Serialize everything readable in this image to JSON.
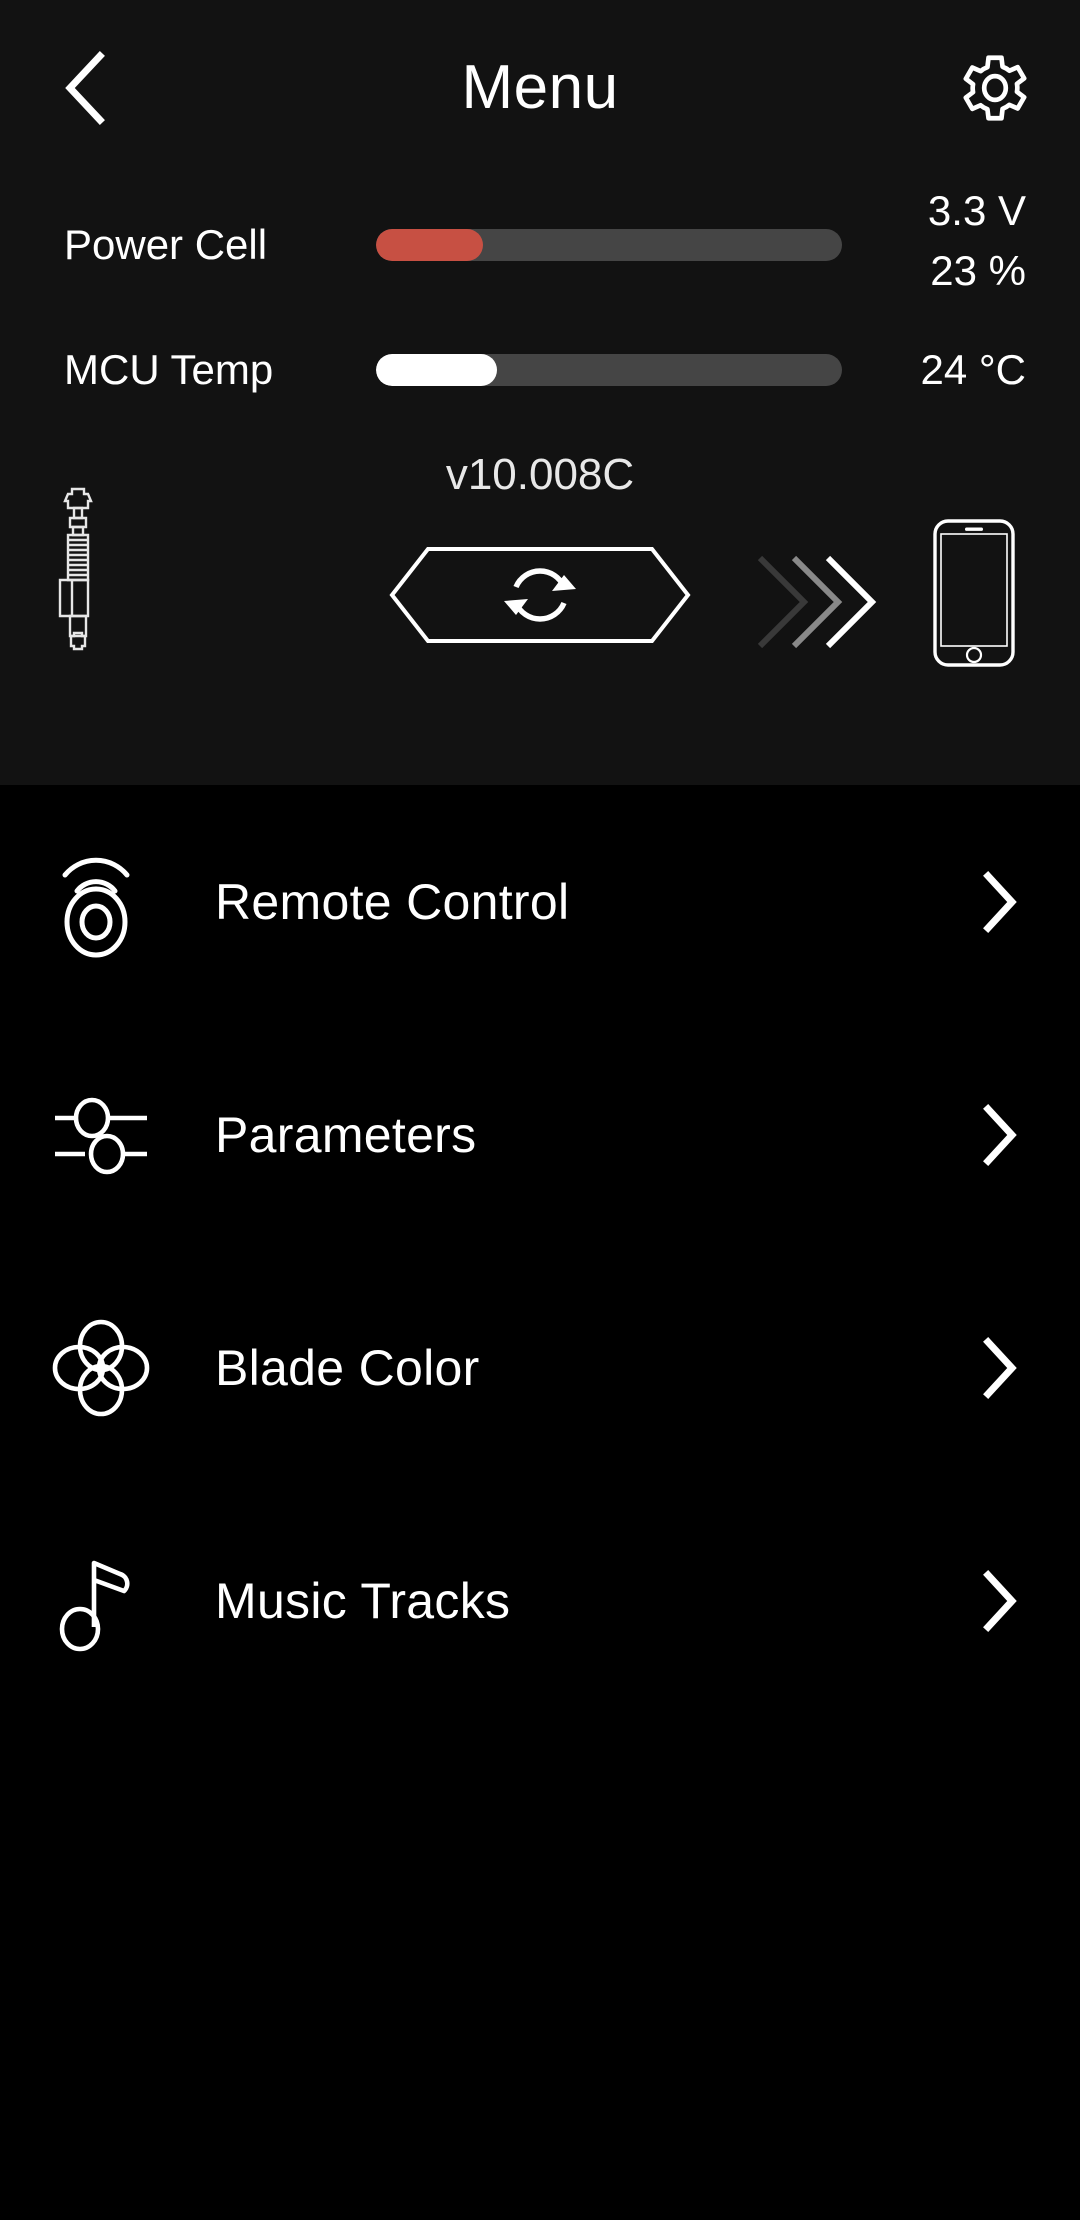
{
  "header": {
    "title": "Menu",
    "back_icon": "chevron-left-icon",
    "settings_icon": "gear-icon"
  },
  "stats": {
    "power_cell": {
      "label": "Power Cell",
      "percent": 23,
      "voltage_text": "3.3 V",
      "percent_text": "23 %",
      "fill_color": "#c75043",
      "track_color": "#454545"
    },
    "mcu_temp": {
      "label": "MCU Temp",
      "percent": 26,
      "value_text": "24 °C",
      "fill_color": "#ffffff",
      "track_color": "#454545"
    }
  },
  "sync": {
    "version": "v10.008C",
    "device_icon": "lightsaber-hilt-icon",
    "sync_button_icon": "refresh-sync-icon",
    "transfer_icon": "double-chevron-right-icon",
    "phone_icon": "smartphone-icon"
  },
  "menu": {
    "items": [
      {
        "label": "Remote Control",
        "icon": "remote-control-icon",
        "chevron": "chevron-right-icon"
      },
      {
        "label": "Parameters",
        "icon": "sliders-icon",
        "chevron": "chevron-right-icon"
      },
      {
        "label": "Blade Color",
        "icon": "color-wheel-icon",
        "chevron": "chevron-right-icon"
      },
      {
        "label": "Music Tracks",
        "icon": "music-note-icon",
        "chevron": "chevron-right-icon"
      }
    ]
  },
  "colors": {
    "panel_background": "#121212",
    "list_background": "#000000",
    "foreground": "#ffffff",
    "accent_red": "#c75043"
  }
}
